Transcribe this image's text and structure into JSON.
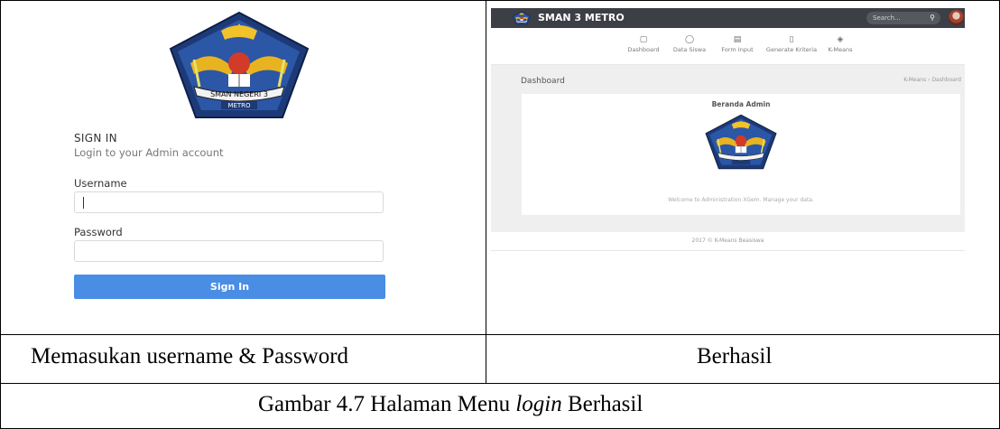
{
  "login": {
    "title": "SIGN IN",
    "subtitle": "Login to your Admin account",
    "username_label": "Username",
    "username_value": "",
    "password_label": "Password",
    "password_value": "",
    "signin_button": "Sign In"
  },
  "logo_motto": "METRO",
  "logo_ribbon": "SMAN NEGERI 3",
  "dashboard": {
    "app_name": "SMAN 3 METRO",
    "search_placeholder": "Search...",
    "nav": [
      {
        "label": "Dashboard",
        "icon": "monitor-icon"
      },
      {
        "label": "Data Siswa",
        "icon": "user-icon"
      },
      {
        "label": "Form Input",
        "icon": "document-icon"
      },
      {
        "label": "Generate Kriteria",
        "icon": "file-icon"
      },
      {
        "label": "K-Means",
        "icon": "layers-icon"
      }
    ],
    "page_title": "Dashboard",
    "breadcrumb": "K-Means  ›  Dashboard",
    "card_title": "Beranda Admin",
    "welcome_text": "Welcome to Administration XGem. Manage your data.",
    "footer": "2017 © K-Means Beasiswa"
  },
  "captions": {
    "left": "Memasukan username & Password",
    "right": "Berhasil",
    "figure_prefix": "Gambar 4.7 Halaman Menu ",
    "figure_italic": "login",
    "figure_suffix": " Berhasil"
  },
  "colors": {
    "topbar": "#3c3f45",
    "button": "#4a8de4",
    "content_bg": "#efefef"
  }
}
